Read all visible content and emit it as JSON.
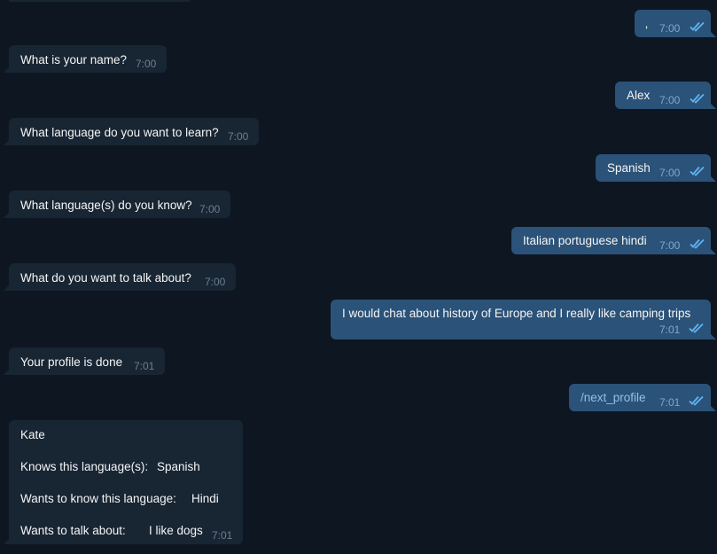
{
  "messages": {
    "m1_out": {
      "text": "‚",
      "time": "7:00"
    },
    "m2_in": {
      "text": "What is your name?",
      "time": "7:00"
    },
    "m3_out": {
      "text": "Alex",
      "time": "7:00"
    },
    "m4_in": {
      "text": "What language do you want to learn?",
      "time": "7:00"
    },
    "m5_out": {
      "text": "Spanish",
      "time": "7:00"
    },
    "m6_in": {
      "text": "What language(s) do you know?",
      "time": "7:00"
    },
    "m7_out": {
      "text": "Italian portuguese hindi",
      "time": "7:00"
    },
    "m8_in": {
      "text": "What do you want to talk about?",
      "time": "7:00"
    },
    "m9_out": {
      "text": "I would chat about history of Europe and I really like camping trips",
      "time": "7:01"
    },
    "m10_in": {
      "text": "Your profile is done",
      "time": "7:01"
    },
    "m11_out": {
      "text": "/next_profile",
      "time": "7:01"
    },
    "profile": {
      "name": "Kate",
      "knows_label": "Knows this language(s):",
      "knows_value": "Spanish",
      "wants_label": "Wants to know this language:",
      "wants_value": "Hindi",
      "talk_label": "Wants to talk about:",
      "talk_value": "I like dogs",
      "time": "7:01"
    }
  },
  "icons": {
    "read_receipt": "double-check-icon"
  },
  "colors": {
    "background": "#0e1621",
    "incoming_bubble": "#182533",
    "outgoing_bubble": "#2b5278",
    "text": "#f5f5f5",
    "incoming_time": "#6d7f8f",
    "outgoing_time": "#7da8d3",
    "read_check": "#5fb4f3",
    "command_link": "#8fc0ef"
  }
}
